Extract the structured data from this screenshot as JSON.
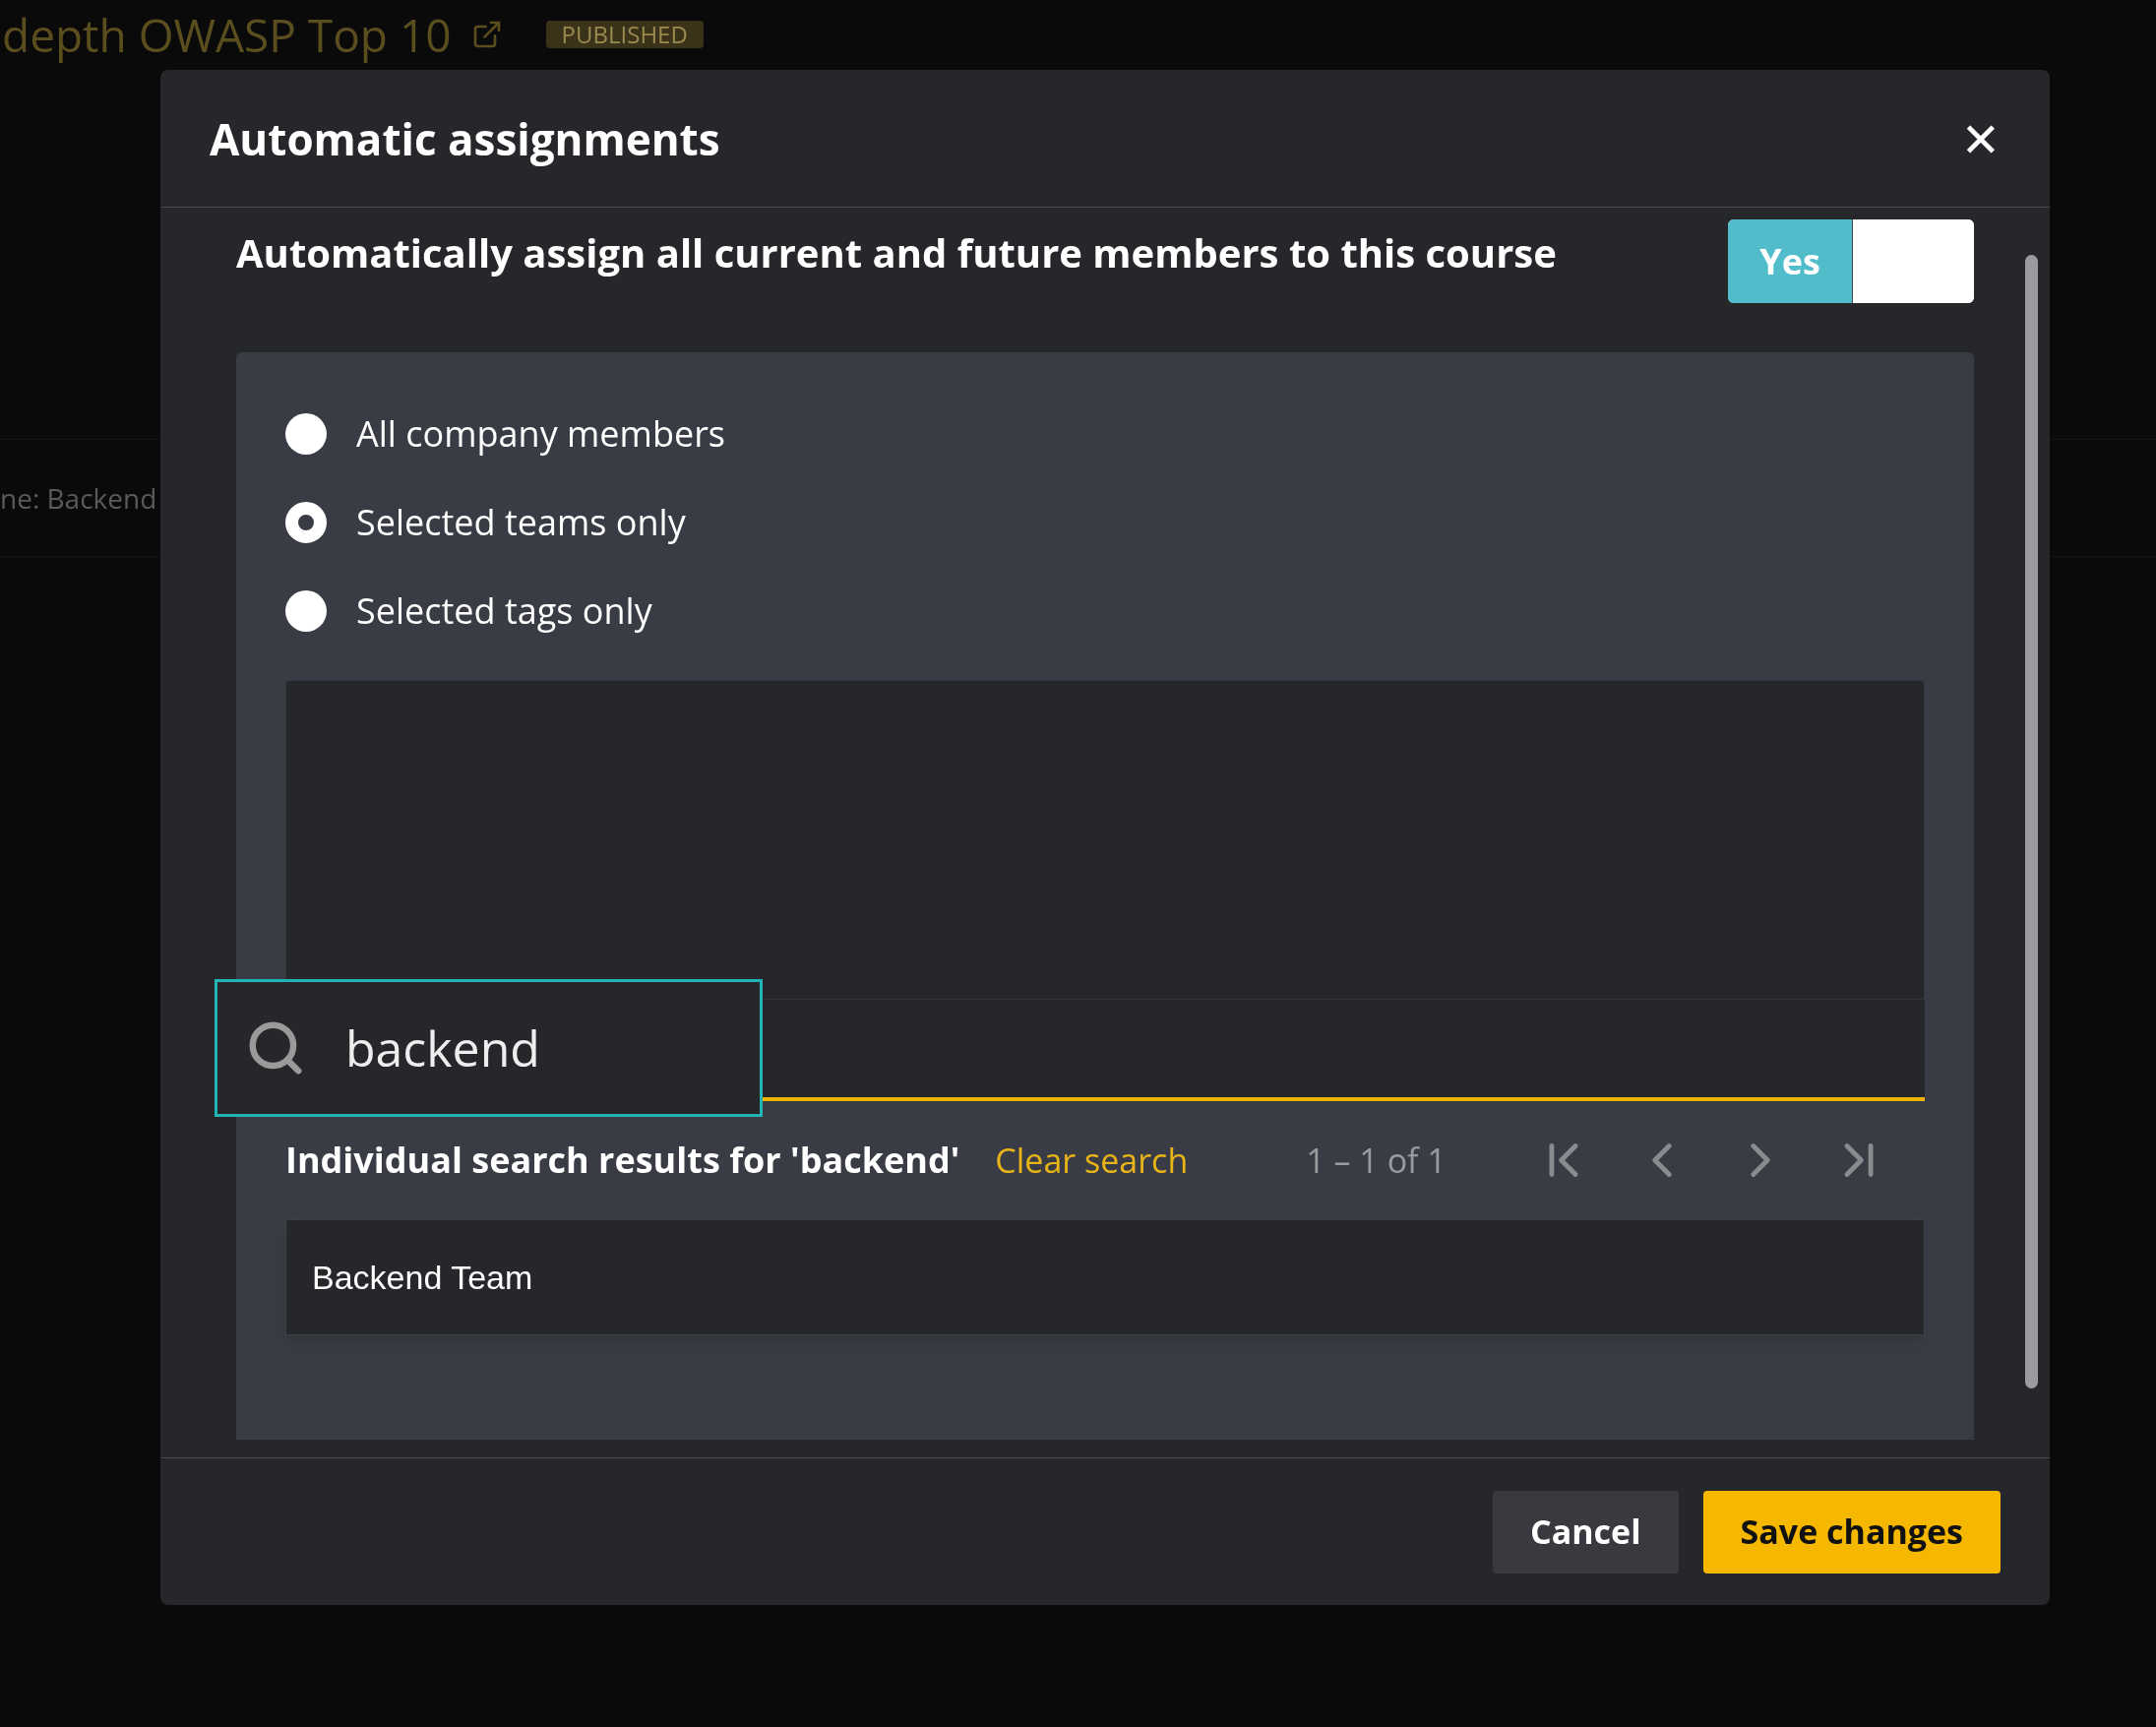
{
  "background_page": {
    "title": "depth OWASP Top 10",
    "status_badge": "PUBLISHED",
    "filter_text": "ne: Backend"
  },
  "dialog": {
    "title": "Automatic assignments",
    "close_label": "✕",
    "auto_assign": {
      "label": "Automatically assign all current and future members to this course",
      "toggle_label": "Yes",
      "on": true
    },
    "scope_options": [
      {
        "label": "All company members",
        "selected": false
      },
      {
        "label": "Selected teams only",
        "selected": true
      },
      {
        "label": "Selected tags only",
        "selected": false
      }
    ],
    "search": {
      "value": "backend"
    },
    "results": {
      "heading": "Individual search results for 'backend'",
      "clear_link": "Clear search",
      "range": "1 – 1 of 1",
      "rows": [
        "Backend Team"
      ]
    },
    "buttons": [
      {
        "label": "Cancel",
        "kind": "secondary"
      },
      {
        "label": "Save changes",
        "kind": "primary"
      }
    ]
  }
}
